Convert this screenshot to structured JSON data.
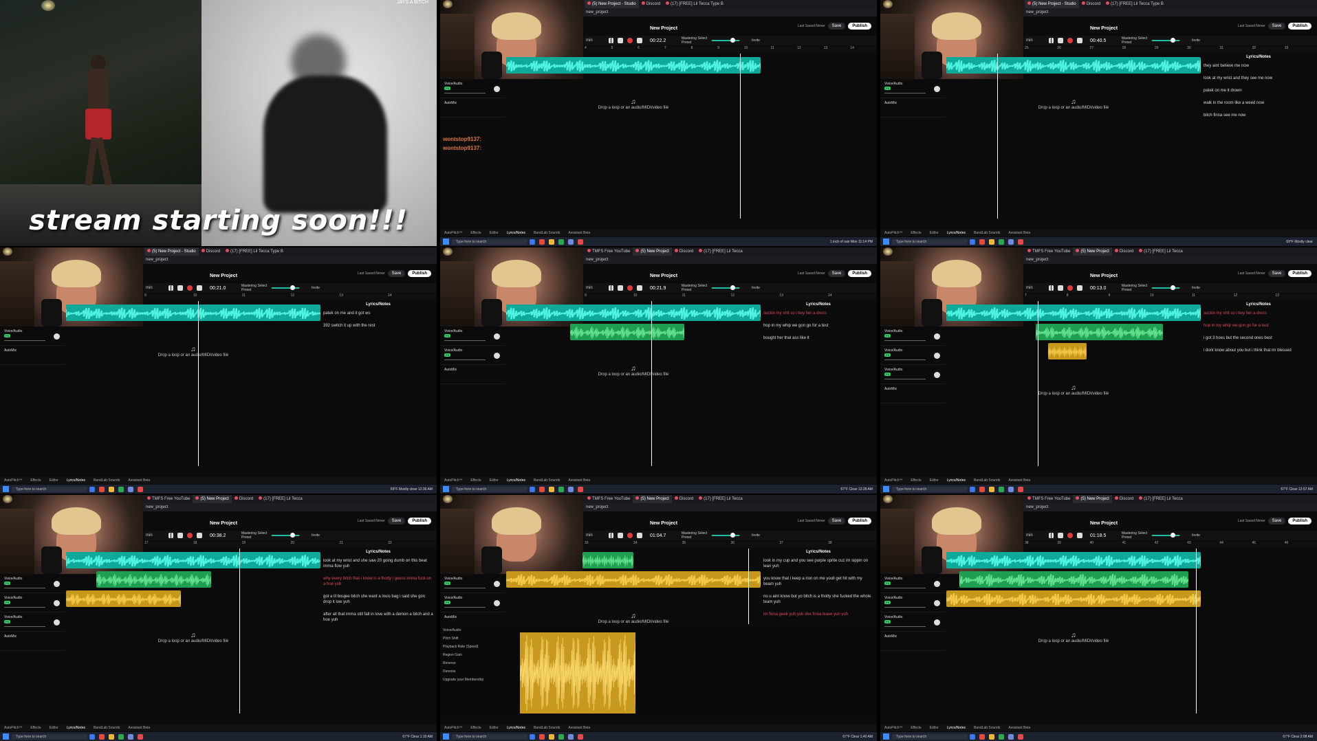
{
  "intro": {
    "title": "stream starting soon!!!",
    "corner_tag": "JAYS A BITCH"
  },
  "common": {
    "project_title": "New Project",
    "url": "new_project",
    "save": "Save",
    "publish": "Publish",
    "last_saved": "Last Saved Never",
    "invite": "Invite",
    "mastering": "Mastering Select Preset",
    "drop_text": "Drop a loop or an audio/MIDI/video file",
    "lyrics_header": "Lyrics/Notes",
    "bottom": [
      "AutoPitch™",
      "Effects",
      "Editor",
      "Lyrics/Notes",
      "BandLab Sounds",
      "Assistant Beta"
    ],
    "taskbar_search": "Type here to search",
    "track_voice": "Voice/Audio",
    "track_auto": "AutoMix"
  },
  "cells": [
    {
      "time": "00:22.2",
      "ruler": [
        "4",
        "5",
        "6",
        "7",
        "8",
        "9",
        "10",
        "11",
        "12",
        "13",
        "14"
      ],
      "tabs": [
        "(5) New Project - Studio",
        "Discord",
        "(17) [FREE] Lil Tecca Type B"
      ],
      "lyrics": [],
      "chat": [
        "wontstop9137:",
        "wontstop9137:"
      ],
      "tray": "1 inch of rain Mon  11:14 PM"
    },
    {
      "time": "00:40.5",
      "ruler": [
        "25",
        "26",
        "27",
        "28",
        "29",
        "30",
        "31",
        "32",
        "33"
      ],
      "tabs": [
        "(5) New Project - Studio",
        "Discord",
        "(17) [FREE] Lil Tecca Type B"
      ],
      "lyrics": [
        "they aint believe me now",
        "look at my wrist and they see me now",
        "patek on me it drown",
        "walk in the room like a weed now",
        "bitch finna see me now"
      ],
      "tray": "69°F Mostly clear"
    },
    {
      "time": "00:21.0",
      "ruler": [
        "9",
        "10",
        "11",
        "12",
        "13",
        "14"
      ],
      "tabs": [
        "(5) New Project - Studio",
        "Discord",
        "(17) [FREE] Lil Tecca Type B"
      ],
      "lyrics": [
        "patek on me and it got ws",
        "392 switch it up with the rest"
      ],
      "tray": "69°F Mostly clear  12:06 AM"
    },
    {
      "time": "00:21.9",
      "ruler": [
        "9",
        "10",
        "11",
        "12",
        "13",
        "14"
      ],
      "tabs": [
        "TMFS Free YouTube",
        "(5) New Project",
        "Discord",
        "(17) [FREE] Lil Tecca"
      ],
      "lyrics": [
        "suckin my shit so i buy her a dress",
        "hop in my whip we gon go for a test",
        "bought her that ass like it"
      ],
      "tray": "67°F Clear  12:28 AM"
    },
    {
      "time": "00:13.0",
      "ruler": [
        "7",
        "8",
        "9",
        "10",
        "11",
        "12",
        "13"
      ],
      "tabs": [
        "TMFS Free YouTube",
        "(5) New Project",
        "Discord",
        "(17) [FREE] Lil Tecca"
      ],
      "lyrics": [
        "suckin my shit so i buy her a dress",
        "hop in my whip we gon go for a test",
        "i got 3 hoes but the second ones best",
        "i dont know about you but i think that im blessed"
      ],
      "tray": "67°F Clear  12:57 AM"
    },
    {
      "time": "00:38.2",
      "ruler": [
        "17",
        "18",
        "19",
        "20",
        "21",
        "22"
      ],
      "tabs": [
        "TMFS Free YouTube",
        "(5) New Project",
        "Discord",
        "(17) [FREE] Lil Tecca"
      ],
      "lyrics": [
        "look at my wrist and she saw 20 going dumb on this beat imma flow yuh",
        "why every bitch that i know is a thotty i guess imma fuck on a hoe yuh",
        "got a lil boujee bitch she want a louis bag i said she gon drop it low yuh",
        "after all that imma still fall in love with a demon a bitch and a hoe yuh"
      ],
      "tray": "67°F Clear  1:10 AM"
    },
    {
      "time": "01:04.7",
      "ruler": [
        "33",
        "34",
        "35",
        "36",
        "37",
        "38"
      ],
      "tabs": [
        "TMFS Free YouTube",
        "(5) New Project",
        "Discord",
        "(17) [FREE] Lil Tecca"
      ],
      "lyrics": [
        "look in my cup and you see purple sprite cuz im sippin on lean yuh",
        "you know that i keep a iron on me youll get hit with my beam yuh",
        "no u aint know but yo bitch is a thotty she fucked the whole team yuh",
        "im finna geek yuh yuh she finna leave yuh yuh"
      ],
      "editor": [
        "Voice/Audio",
        "Pitch Shift",
        "Playback Rate (Speed)",
        "Region Gain",
        "Reverse",
        "Denoise",
        "Upgrade your Membership"
      ],
      "tray": "67°F Clear  1:40 AM"
    },
    {
      "time": "01:18.5",
      "ruler": [
        "38",
        "39",
        "40",
        "41",
        "42",
        "43",
        "44",
        "45",
        "46"
      ],
      "tabs": [
        "TMFS Free YouTube",
        "(5) New Project",
        "Discord",
        "(17) [FREE] Lil Tecca"
      ],
      "lyrics": [],
      "tray": "67°F Clear  2:08 AM"
    }
  ],
  "colors": {
    "teal": "#10a899",
    "green": "#1f9d52",
    "yellow": "#c6961d",
    "record": "#e23b3b"
  }
}
